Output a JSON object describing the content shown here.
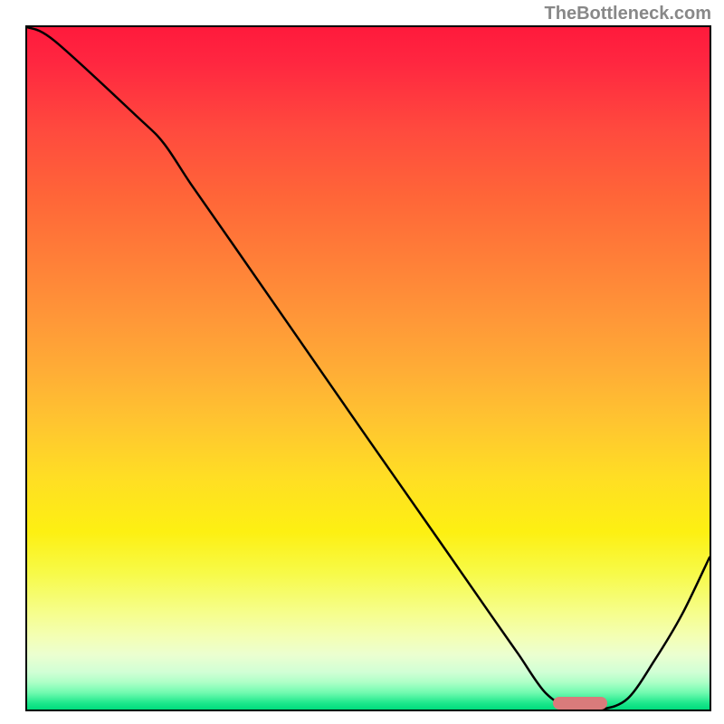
{
  "attribution": "TheBottleneck.com",
  "chart_data": {
    "type": "line",
    "title": "",
    "xlabel": "",
    "ylabel": "",
    "xlim": [
      0,
      100
    ],
    "ylim": [
      0,
      100
    ],
    "x": [
      0,
      4,
      16,
      20,
      24,
      30,
      40,
      50,
      60,
      68,
      72,
      76,
      80,
      84,
      88,
      92,
      96,
      100
    ],
    "values": [
      100,
      98,
      87,
      83,
      77,
      68.4,
      54,
      39.6,
      25.3,
      13.8,
      8.1,
      2.4,
      0,
      0,
      1.6,
      7.3,
      14,
      22.3
    ],
    "minimum_band": {
      "x_start": 77,
      "x_end": 85,
      "y": 0
    },
    "background_gradient": {
      "type": "vertical",
      "stops": [
        {
          "pos": 0.0,
          "color": "#ff1a3c"
        },
        {
          "pos": 0.5,
          "color": "#ffac36"
        },
        {
          "pos": 0.74,
          "color": "#fdf012"
        },
        {
          "pos": 0.92,
          "color": "#ebffd0"
        },
        {
          "pos": 1.0,
          "color": "#00db7c"
        }
      ]
    }
  }
}
